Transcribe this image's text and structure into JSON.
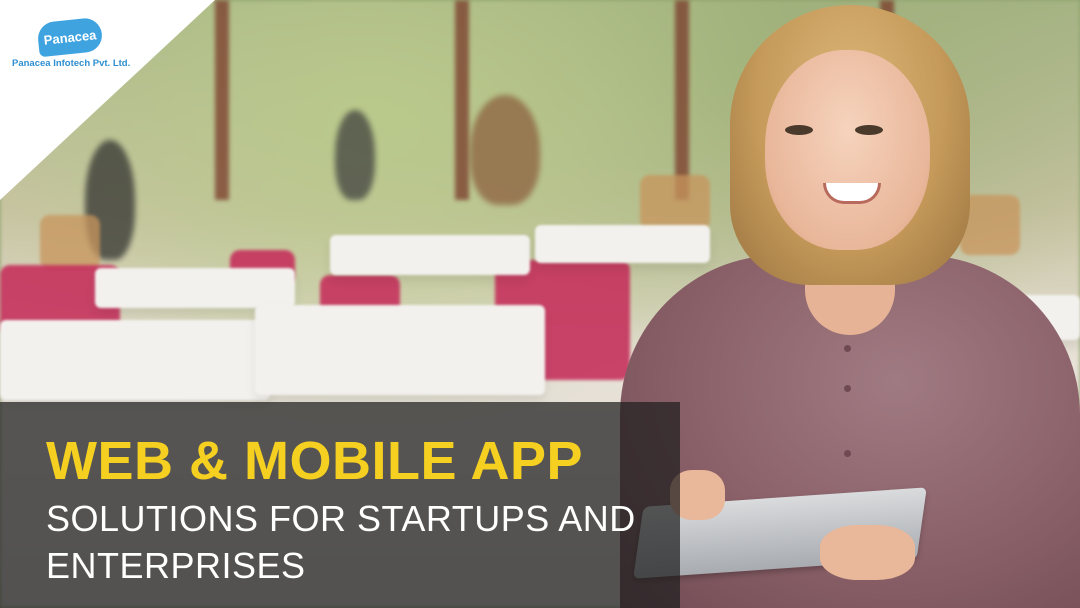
{
  "brand": {
    "logo_word": "Panacea",
    "company_name": "Panacea Infotech Pvt. Ltd.",
    "logo_color": "#3fa3e0"
  },
  "banner": {
    "headline": "WEB & MOBILE APP",
    "subline_1": "SOLUTIONS FOR STARTUPS AND",
    "subline_2": "ENTERPRISES",
    "headline_color": "#f5d020",
    "subline_color": "#ffffff",
    "panel_color": "rgba(30,30,30,0.72)"
  }
}
